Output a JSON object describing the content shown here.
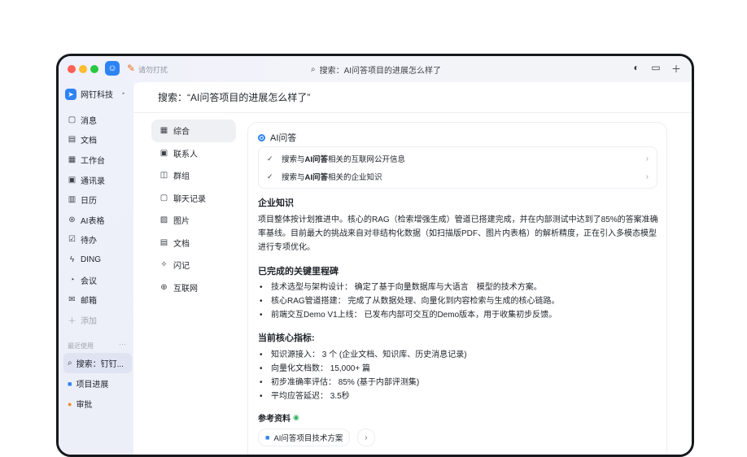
{
  "titlebar": {
    "dnd_label": "请勿打扰",
    "search_text": "搜索：AI问答项目的进展怎么样了",
    "icons": [
      "history-icon",
      "screen-icon",
      "plus-icon"
    ]
  },
  "sidebar": {
    "org_name": "网钉科技",
    "items": [
      {
        "label": "消息",
        "icon": "message-icon"
      },
      {
        "label": "文档",
        "icon": "document-icon"
      },
      {
        "label": "工作台",
        "icon": "grid-icon"
      },
      {
        "label": "通讯录",
        "icon": "contacts-icon"
      },
      {
        "label": "日历",
        "icon": "calendar-icon"
      },
      {
        "label": "AI表格",
        "icon": "ai-table-icon"
      },
      {
        "label": "待办",
        "icon": "todo-icon"
      },
      {
        "label": "DING",
        "icon": "ding-icon"
      },
      {
        "label": "会议",
        "icon": "meeting-icon"
      },
      {
        "label": "邮箱",
        "icon": "mail-icon"
      }
    ],
    "add_label": "添加",
    "recent_title": "最近使用",
    "recent": [
      {
        "label": "搜索：钉钉...",
        "icon": "search-icon"
      },
      {
        "label": "项目进展",
        "icon": "doc-blue-icon"
      },
      {
        "label": "审批",
        "icon": "approval-icon"
      }
    ]
  },
  "main": {
    "title": "搜索：“AI问答项目的进展怎么样了”",
    "filters": [
      {
        "label": "综合",
        "icon": "grid-icon"
      },
      {
        "label": "联系人",
        "icon": "contact-icon"
      },
      {
        "label": "群组",
        "icon": "group-icon"
      },
      {
        "label": "聊天记录",
        "icon": "chat-record-icon"
      },
      {
        "label": "图片",
        "icon": "image-icon"
      },
      {
        "label": "文档",
        "icon": "document-icon"
      },
      {
        "label": "闪记",
        "icon": "flash-note-icon"
      },
      {
        "label": "互联网",
        "icon": "globe-icon"
      }
    ],
    "ai": {
      "title": "AI问答",
      "steps": [
        {
          "pre": "搜索与",
          "bold": "AI问答",
          "post": "相关的互联网公开信息"
        },
        {
          "pre": "搜索与",
          "bold": "AI问答",
          "post": "相关的企业知识"
        }
      ],
      "section1_title": "企业知识",
      "section1_text": "项目整体按计划推进中。核心的RAG（检索增强生成）管道已搭建完成，并在内部测试中达到了85%的答案准确率基线。目前最大的挑战来自对非结构化数据（如扫描版PDF、图片内表格）的解析精度，正在引入多模态模型进行专项优化。",
      "section2_title": "已完成的关键里程碑",
      "milestones": [
        "技术选型与架构设计： 确定了基于向量数据库与大语言　模型的技术方案。",
        "核心RAG管道搭建： 完成了从数据处理、向量化到内容检索与生成的核心链路。",
        "前端交互Demo V1上线： 已发布内部可交互的Demo版本，用于收集初步反馈。"
      ],
      "section3_title": "当前核心指标:",
      "metrics": [
        "知识源接入： 3 个 (企业文档、知识库、历史消息记录)",
        "向量化文档数： 15,000+ 篇",
        "初步准确率评估： 85% (基于内部评测集)",
        "平均应答延迟： 3.5秒"
      ],
      "refs_title": "参考资料",
      "ref_chip": "AI问答项目技术方案"
    }
  }
}
